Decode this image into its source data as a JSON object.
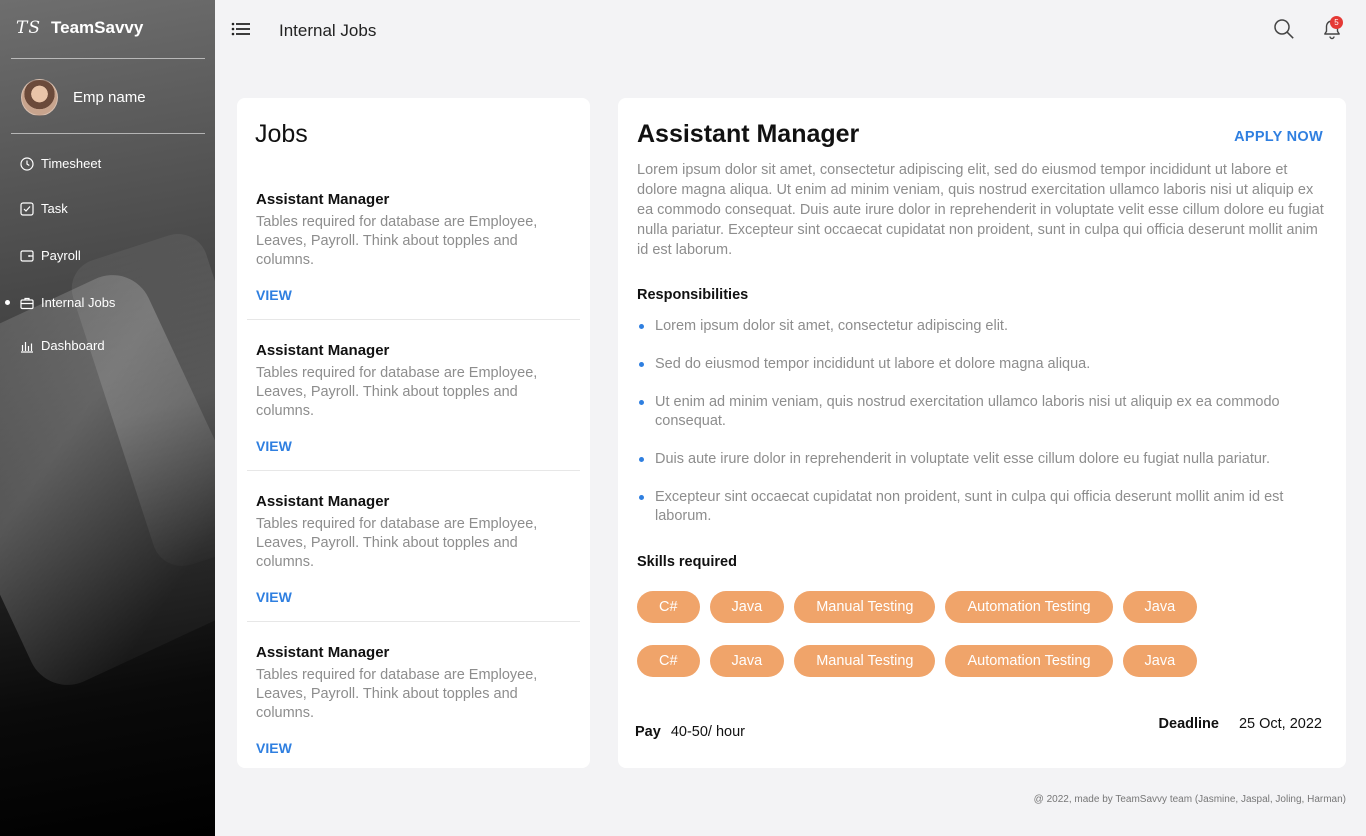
{
  "brand": {
    "logo": "TS",
    "name": "TeamSavvy"
  },
  "profile": {
    "name": "Emp name"
  },
  "nav": [
    {
      "label": "Timesheet",
      "icon": "clock-icon",
      "active": false
    },
    {
      "label": "Task",
      "icon": "checkbox-icon",
      "active": false
    },
    {
      "label": "Payroll",
      "icon": "payroll-icon",
      "active": false
    },
    {
      "label": "Internal Jobs",
      "icon": "briefcase-icon",
      "active": true
    },
    {
      "label": "Dashboard",
      "icon": "chart-icon",
      "active": false
    }
  ],
  "header": {
    "title": "Internal Jobs",
    "notification_count": "5"
  },
  "jobs": {
    "title": "Jobs",
    "items": [
      {
        "title": "Assistant Manager",
        "desc": "Tables required for database are Employee, Leaves, Payroll. Think about topples and columns.",
        "view": "VIEW"
      },
      {
        "title": "Assistant Manager",
        "desc": "Tables required for database are Employee, Leaves, Payroll. Think about topples and columns.",
        "view": "VIEW"
      },
      {
        "title": "Assistant Manager",
        "desc": "Tables required for database are Employee, Leaves, Payroll. Think about topples and columns.",
        "view": "VIEW"
      },
      {
        "title": "Assistant Manager",
        "desc": "Tables required for database are Employee, Leaves, Payroll. Think about topples and columns.",
        "view": "VIEW"
      }
    ]
  },
  "detail": {
    "title": "Assistant Manager",
    "apply": "APPLY NOW",
    "description": "Lorem ipsum dolor sit amet, consectetur adipiscing elit, sed do eiusmod tempor incididunt ut labore et dolore magna aliqua. Ut enim ad minim veniam, quis nostrud exercitation ullamco laboris nisi ut aliquip ex ea commodo consequat. Duis aute irure dolor in reprehenderit in voluptate velit esse cillum dolore eu fugiat nulla pariatur. Excepteur sint occaecat cupidatat non proident, sunt in culpa qui officia deserunt mollit anim id est laborum.",
    "responsibilities_title": "Responsibilities",
    "responsibilities": [
      "Lorem ipsum dolor sit amet, consectetur adipiscing elit.",
      "Sed do eiusmod tempor incididunt ut labore et dolore magna aliqua.",
      "Ut enim ad minim veniam, quis nostrud exercitation ullamco laboris nisi ut aliquip ex ea commodo consequat.",
      "Duis aute irure dolor in reprehenderit in voluptate velit esse cillum dolore eu fugiat nulla pariatur.",
      "Excepteur sint occaecat cupidatat non proident, sunt in culpa qui officia deserunt mollit anim id est laborum."
    ],
    "skills_title": "Skills required",
    "skills_rows": [
      [
        "C#",
        "Java",
        "Manual Testing",
        "Automation Testing",
        "Java"
      ],
      [
        "C#",
        "Java",
        "Manual Testing",
        "Automation Testing",
        "Java"
      ]
    ],
    "pay_label": "Pay",
    "pay_value": "40-50/ hour",
    "deadline_label": "Deadline",
    "deadline_value": "25 Oct, 2022"
  },
  "footer": "@ 2022, made by TeamSavvy team (Jasmine, Jaspal, Joling, Harman)",
  "colors": {
    "accent": "#2f7fe0",
    "skill": "#f0a46a",
    "badge": "#e53935"
  }
}
